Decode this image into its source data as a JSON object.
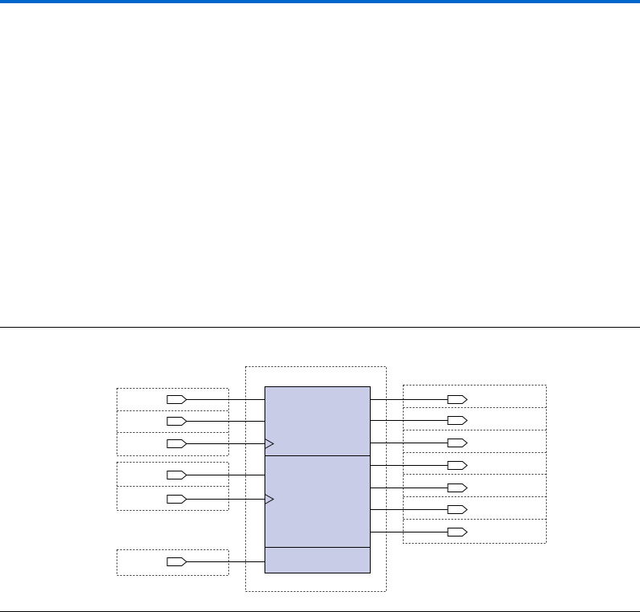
{
  "colors": {
    "top_bar": "#0066cc",
    "block_fill": "#c8cce6",
    "stroke": "#000000",
    "dashed": "#333333"
  },
  "diagram": {
    "left_ports": [
      {
        "id": "in-1",
        "group": 1,
        "pin": "data",
        "label": ""
      },
      {
        "id": "in-2",
        "group": 1,
        "pin": "data",
        "label": ""
      },
      {
        "id": "in-3",
        "group": 1,
        "pin": "clock",
        "label": ""
      },
      {
        "id": "in-4",
        "group": 2,
        "pin": "data",
        "label": ""
      },
      {
        "id": "in-5",
        "group": 2,
        "pin": "clock",
        "label": ""
      },
      {
        "id": "in-6",
        "group": 3,
        "pin": "data",
        "label": ""
      }
    ],
    "right_ports": [
      {
        "id": "out-1",
        "label": ""
      },
      {
        "id": "out-2",
        "label": ""
      },
      {
        "id": "out-3",
        "label": ""
      },
      {
        "id": "out-4",
        "label": ""
      },
      {
        "id": "out-5",
        "label": ""
      },
      {
        "id": "out-6",
        "label": ""
      },
      {
        "id": "out-7",
        "label": ""
      }
    ],
    "block_sections": [
      {
        "id": "upper",
        "label": ""
      },
      {
        "id": "middle",
        "label": ""
      },
      {
        "id": "lower",
        "label": ""
      }
    ]
  }
}
